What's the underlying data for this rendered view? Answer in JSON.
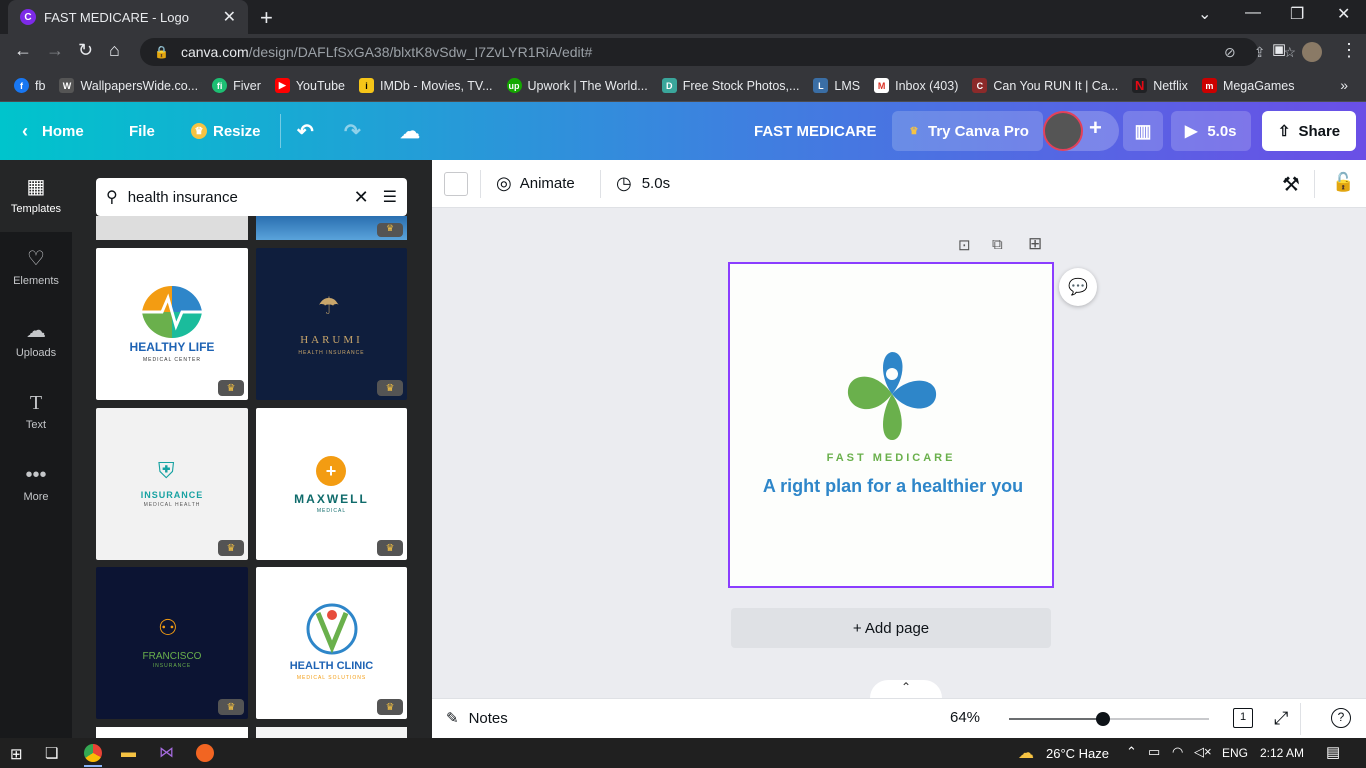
{
  "browser": {
    "tab_title": "FAST MEDICARE - Logo",
    "url_domain": "canva.com",
    "url_path": "/design/DAFLfSxGA38/blxtK8vSdw_I7ZvLYR1RiA/edit#",
    "bookmarks": [
      "fb",
      "WallpapersWide.co...",
      "Fiver",
      "YouTube",
      "IMDb - Movies, TV...",
      "Upwork | The World...",
      "Free Stock Photos,...",
      "LMS",
      "Inbox (403)",
      "Can You RUN It | Ca...",
      "Netflix",
      "MegaGames"
    ]
  },
  "header": {
    "home": "Home",
    "file": "File",
    "resize": "Resize",
    "design_title": "FAST MEDICARE",
    "try_pro": "Try Canva Pro",
    "duration": "5.0s",
    "share": "Share"
  },
  "rail": {
    "templates": "Templates",
    "elements": "Elements",
    "uploads": "Uploads",
    "text": "Text",
    "more": "More"
  },
  "search": {
    "value": "health insurance"
  },
  "templates": [
    {
      "title": "HEALTHY LIFE",
      "sub": "MEDICAL CENTER"
    },
    {
      "title": "HARUMI",
      "sub": "HEALTH INSURANCE"
    },
    {
      "title": "INSURANCE",
      "sub": "MEDICAL HEALTH"
    },
    {
      "title": "MAXWELL",
      "sub": "MEDICAL"
    },
    {
      "title": "FRANCISCO",
      "sub": "INSURANCE"
    },
    {
      "title": "HEALTH CLINIC",
      "sub": "MEDICAL SOLUTIONS"
    }
  ],
  "toolbar": {
    "animate": "Animate",
    "duration": "5.0s"
  },
  "canvas": {
    "brand": "FAST MEDICARE",
    "tagline": "A right plan for a healthier you"
  },
  "add_page": "+ Add page",
  "footer": {
    "notes": "Notes",
    "zoom": "64%",
    "page_count": "1",
    "zoom_fraction": 0.47
  },
  "taskbar": {
    "weather": "26°C  Haze",
    "lang": "ENG",
    "time": "2:12 AM"
  },
  "colors": {
    "accent": "#8b3dff",
    "green": "#6ab04c",
    "blue": "#2e86c9"
  }
}
